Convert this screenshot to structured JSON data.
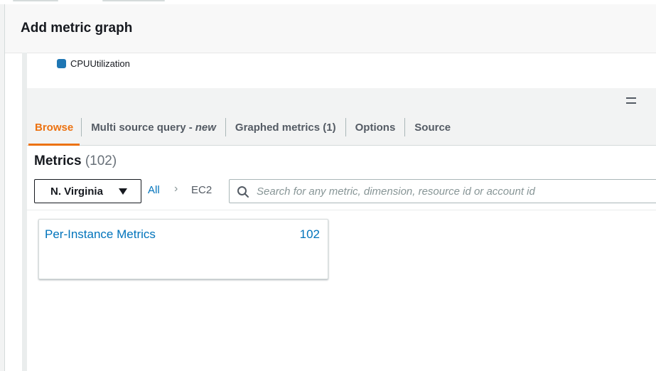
{
  "modal": {
    "title": "Add metric graph"
  },
  "legend": {
    "label": "CPUUtilization",
    "color": "#1f77b4"
  },
  "tabs": [
    {
      "label": "Browse",
      "active": true
    },
    {
      "label": "Multi source query - ",
      "suffix": "new",
      "active": false
    },
    {
      "label": "Graphed metrics (1)",
      "active": false
    },
    {
      "label": "Options",
      "active": false
    },
    {
      "label": "Source",
      "active": false
    }
  ],
  "metrics": {
    "title": "Metrics",
    "count": "(102)"
  },
  "region": {
    "label": "N. Virginia",
    "icon": "caret-down-icon"
  },
  "breadcrumb": {
    "all": "All",
    "separator": "›",
    "current": "EC2"
  },
  "search": {
    "placeholder": "Search for any metric, dimension, resource id or account id",
    "value": "",
    "icon": "search-icon"
  },
  "namespaces": [
    {
      "label": "Per-Instance Metrics",
      "count": "102"
    }
  ],
  "colors": {
    "accent": "#ec7211",
    "link": "#0073bb"
  }
}
